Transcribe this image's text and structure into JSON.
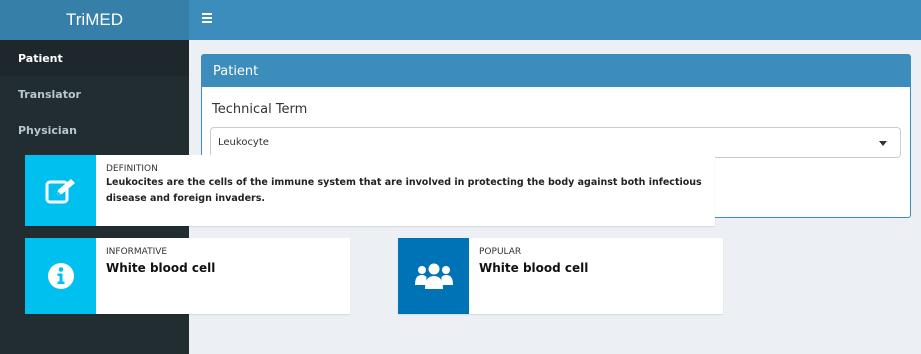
{
  "app": {
    "title": "TriMED"
  },
  "sidebar": {
    "items": [
      {
        "label": "Patient"
      },
      {
        "label": "Translator"
      },
      {
        "label": "Physician"
      }
    ]
  },
  "box": {
    "header": "Patient",
    "field_label": "Technical Term",
    "select_value": "Leukocyte"
  },
  "definition": {
    "title": "DEFINITION",
    "text": "Leukocites are the cells of the immune system that are involved in protecting the body against both infectious disease and foreign invaders.",
    "icon": "edit-icon",
    "color": "#00c0ef"
  },
  "informative": {
    "title": "INFORMATIVE",
    "value": "White blood cell",
    "icon": "info-icon",
    "color": "#00c0ef"
  },
  "popular": {
    "title": "POPULAR",
    "value": "White blood cell",
    "icon": "users-icon",
    "color": "#0073b7"
  }
}
